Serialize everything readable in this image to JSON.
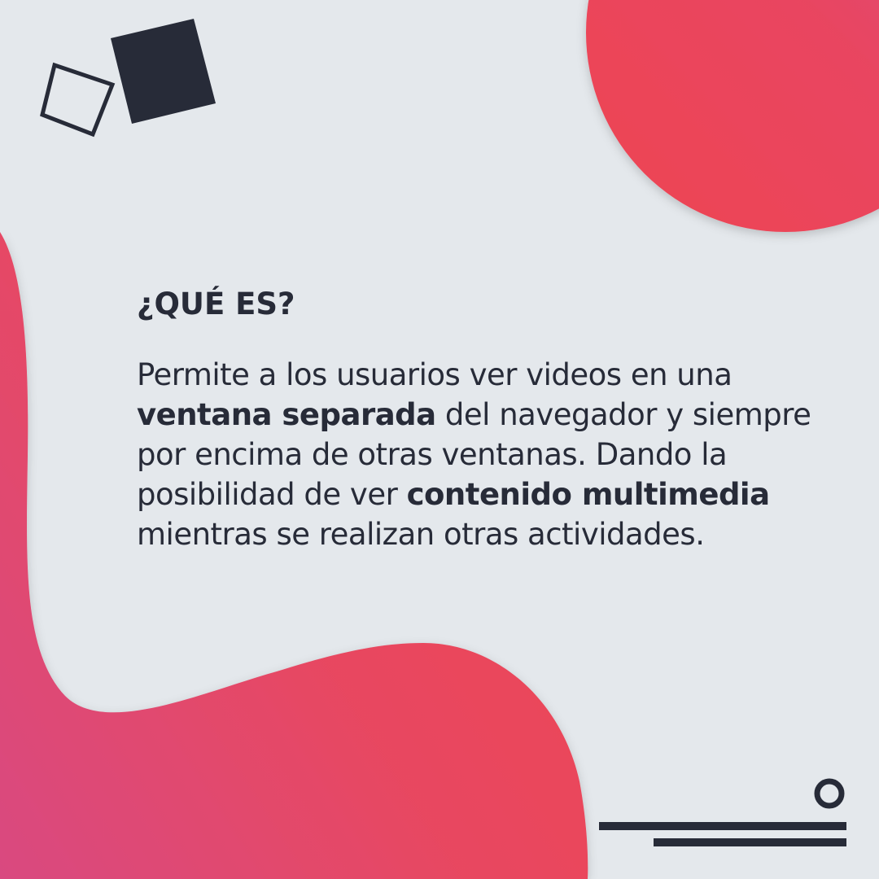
{
  "heading": "¿QUÉ ES?",
  "paragraph": {
    "part1": "Permite a los usuarios ver videos en una ",
    "bold1": "ventana separada",
    "part2": " del navegador y siempre por encima de otras ventanas. Dando la posibilidad de ver ",
    "bold2": "contenido multimedia",
    "part3": " mientras se realizan otras actividades."
  },
  "colors": {
    "background": "#e4e8ec",
    "text": "#272b38",
    "accent_red": "#ee4553",
    "accent_pink": "#d94a80",
    "dark_shape": "#272b38"
  },
  "decorations": {
    "top_left": "outlined-square-and-filled-square",
    "top_right": "gradient-circle",
    "bottom_left": "gradient-blob",
    "bottom_right": "ring-and-two-lines"
  }
}
